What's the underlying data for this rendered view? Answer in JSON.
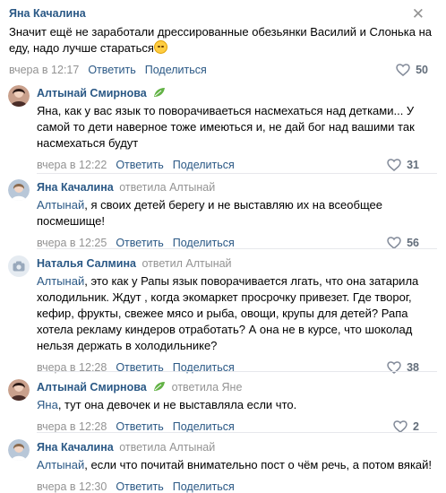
{
  "top_comment": {
    "author": "Яна Качалина",
    "text": "Значит ещё не заработали дрессированные обезьянки Василий и Слонька на еду, надо лучше стараться",
    "time": "вчера в 12:17",
    "reply_label": "Ответить",
    "share_label": "Поделиться",
    "likes": "50"
  },
  "replies": [
    {
      "author": "Алтынай Смирнова",
      "text": "Яна, как у вас язык то поворачиваеться насмехаться над детками... У самой то дети наверное тоже имеються и, не дай бог над вашими так насмехаться будут",
      "time": "вчера в 12:22",
      "reply_label": "Ответить",
      "share_label": "Поделиться",
      "likes": "31"
    },
    {
      "author": "Яна Качалина",
      "replied_to": "ответила Алтынай",
      "mention": "Алтынай",
      "text": ", я своих детей берегу и не выставляю их на всеобщее посмешище!",
      "time": "вчера в 12:25",
      "reply_label": "Ответить",
      "share_label": "Поделиться",
      "likes": "56"
    },
    {
      "author": "Наталья Салмина",
      "replied_to": "ответил Алтынай",
      "mention": "Алтынай",
      "text": ", это как у Рапы язык поворачивается лгать, что она затарила холодильник. Ждут , когда экомаркет просрочку привезет. Где творог, кефир, фрукты, свежее мясо и рыба, овощи, крупы для детей? Рапа хотела рекламу киндеров отработать? А она не в курсе, что шоколад нельзя держать в холодильнике?",
      "time": "вчера в 12:28",
      "reply_label": "Ответить",
      "share_label": "Поделиться",
      "likes": "38"
    },
    {
      "author": "Алтынай Смирнова",
      "replied_to": "ответила Яне",
      "mention": "Яна",
      "text": ", тут она девочек и не выставляла если что.",
      "time": "вчера в 12:28",
      "reply_label": "Ответить",
      "share_label": "Поделиться",
      "likes": "2"
    },
    {
      "author": "Яна Качалина",
      "replied_to": "ответила Алтынай",
      "mention": "Алтынай",
      "text": ", если что почитай внимательно пост о чём речь, а потом вякай!",
      "time": "вчера в 12:30",
      "reply_label": "Ответить",
      "share_label": "Поделиться",
      "likes": ""
    }
  ],
  "colors": {
    "link": "#2a5885",
    "muted": "#939393",
    "divider": "#e7e8ec"
  }
}
